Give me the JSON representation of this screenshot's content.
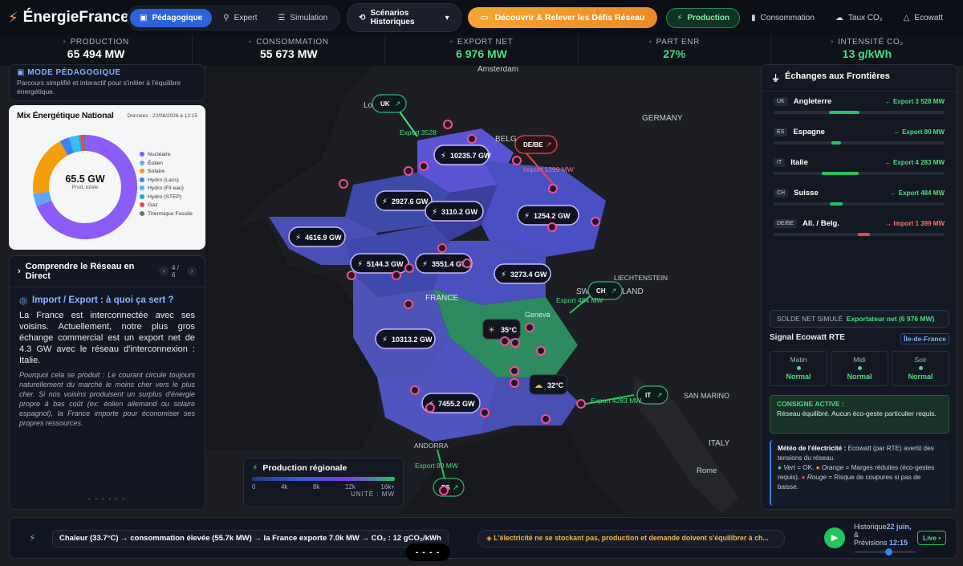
{
  "app": {
    "name": "ÉnergieFrance"
  },
  "nav": {
    "modes": [
      {
        "label": "Pédagogique",
        "icon": "book-icon",
        "active": true
      },
      {
        "label": "Expert",
        "icon": "chart-icon",
        "active": false
      },
      {
        "label": "Simulation",
        "icon": "sliders-icon",
        "active": false
      }
    ],
    "scenarios_label": "Scénarios Historiques",
    "cta_label": "Découvrir & Relever les Défis Réseau",
    "views": [
      {
        "label": "Production",
        "active": true
      },
      {
        "label": "Consommation",
        "active": false
      },
      {
        "label": "Taux CO₂",
        "active": false
      },
      {
        "label": "Ecowatt",
        "active": false
      }
    ]
  },
  "kpis": [
    {
      "label": "PRODUCTION",
      "value": "65 494 MW",
      "green": false
    },
    {
      "label": "CONSOMMATION",
      "value": "55 673 MW",
      "green": false
    },
    {
      "label": "EXPORT NET",
      "value": "6 976 MW",
      "green": true
    },
    {
      "label": "PART ENR",
      "value": "27%",
      "green": true
    },
    {
      "label": "INTENSITÉ CO₂",
      "value": "13 g/kWh",
      "green": true
    }
  ],
  "mode_panel": {
    "title": "MODE PÉDAGOGIQUE",
    "subtitle": "Parcours simplifié et interactif pour s'initier à l'équilibre énergétique."
  },
  "mix": {
    "title": "Mix Énergétique National",
    "date": "Données : 22/06/2026 à 12:15",
    "total": "65.5 GW",
    "total_label": "Prod. totale",
    "legend": [
      {
        "name": "Nucléaire",
        "color": "#8b5cf6"
      },
      {
        "name": "Éolien",
        "color": "#60a5fa"
      },
      {
        "name": "Solaire",
        "color": "#f59e0b"
      },
      {
        "name": "Hydro (Lacs)",
        "color": "#3b82f6"
      },
      {
        "name": "Hydro (Fil eau)",
        "color": "#38bdf8"
      },
      {
        "name": "Hydro (STEP)",
        "color": "#0ea5e9"
      },
      {
        "name": "Gaz",
        "color": "#ef4444"
      },
      {
        "name": "Thermique Fossile",
        "color": "#64748b"
      }
    ]
  },
  "chart_data": {
    "type": "pie",
    "title": "Mix Énergétique National",
    "categories": [
      "Nucléaire",
      "Éolien",
      "Solaire",
      "Hydro (Lacs)",
      "Hydro (Fil eau)",
      "Hydro (STEP)",
      "Gaz",
      "Thermique Fossile"
    ],
    "values": [
      69,
      4,
      19,
      3,
      3,
      0.5,
      1,
      0.5
    ]
  },
  "learn": {
    "title": "Comprendre le Réseau en Direct",
    "page": "4 / 6",
    "question": "Import / Export : à quoi ça sert ?",
    "body": "La France est interconnectée avec ses voisins. Actuellement, notre plus gros échange commercial est un export net de 4.3 GW avec le réseau d'interconnexion : Italie.",
    "note": "Pourquoi cela se produit : Le courant circule toujours naturellement du marché le moins cher vers le plus cher. Si nos voisins produisent un surplus d'énergie propre à bas coût (ex: éolien allemand ou solaire espagnol), la France importe pour économiser ses propres ressources.",
    "dots": "• • • • • •"
  },
  "exchanges": {
    "title": "Échanges aux Frontières",
    "rows": [
      {
        "code": "UK",
        "name": "Angleterre",
        "flow": "← Export 3 528 MW",
        "dir": "export"
      },
      {
        "code": "ES",
        "name": "Espagne",
        "flow": "← Export 80 MW",
        "dir": "export"
      },
      {
        "code": "IT",
        "name": "Italie",
        "flow": "← Export 4 283 MW",
        "dir": "export"
      },
      {
        "code": "CH",
        "name": "Suisse",
        "flow": "← Export 484 MW",
        "dir": "export"
      },
      {
        "code": "DE/BE",
        "name": "All. / Belg.",
        "flow": "→ Import 1 399 MW",
        "dir": "import"
      }
    ],
    "solde_label": "SOLDE NET SIMULÉ",
    "solde_value": "Exportateur net (6 976 MW)",
    "ecowatt_title": "Signal Ecowatt RTE",
    "region": "Île-de-France",
    "slots": [
      {
        "label": "Matin",
        "status": "Normal"
      },
      {
        "label": "Midi",
        "status": "Normal"
      },
      {
        "label": "Soir",
        "status": "Normal"
      }
    ],
    "consigne_title": "CONSIGNE ACTIVE :",
    "consigne_text": "Réseau équilibré. Aucun éco-geste particulier requis.",
    "meteo_title": "Météo de l'électricité :",
    "meteo_text": "Ecowatt (par RTE) avertit des tensions du réseau.",
    "meteo_green": "Vert",
    "meteo_green_text": "= OK.",
    "meteo_orange": "Orange",
    "meteo_orange_text": "= Marges réduites (éco-gestes requis).",
    "meteo_red": "Rouge",
    "meteo_red_text": "= Risque de coupures si pas de baisse."
  },
  "map": {
    "places": [
      "Amsterdam",
      "GERMANY",
      "LIECHTENSTEIN",
      "Geneva",
      "SAN MARINO",
      "ITALY",
      "Rome",
      "ANDORRA",
      "FRANCE",
      "BELG",
      "SWITZ",
      "LAND",
      "Lon"
    ],
    "regions": [
      {
        "value": "10235.7 GW"
      },
      {
        "value": "2927.6 GW"
      },
      {
        "value": "3110.2 GW"
      },
      {
        "value": "1254.2 GW"
      },
      {
        "value": "4616.9 GW"
      },
      {
        "value": "5144.3 GW"
      },
      {
        "value": "3551.4 GW"
      },
      {
        "value": "3273.4 GW"
      },
      {
        "value": "10313.2 GW"
      },
      {
        "value": "7455.2 GW"
      }
    ],
    "weather": [
      {
        "value": "35°C"
      },
      {
        "value": "32°C"
      }
    ],
    "borders": [
      {
        "code": "UK",
        "flow": "Export 3528"
      },
      {
        "code": "DE/BE",
        "flow": "Import 1399 MW"
      },
      {
        "code": "CH",
        "flow": "Export 484 MW"
      },
      {
        "code": "IT",
        "flow": "Export 4283 MW"
      },
      {
        "code": "ES",
        "flow": "Export 80 MW"
      }
    ],
    "gauge_title": "Production régionale",
    "gauge_ticks": [
      "0",
      "4k",
      "8k",
      "12k",
      "16k+"
    ],
    "gauge_unit": "UNITÉ : MW"
  },
  "bottom": {
    "chain": "Chaleur (33.7°C) → consommation élevée (55.7k MW) → la France exporte 7.0k MW → CO₂ : 12 gCO₂/kWh",
    "tip": "L'électricité ne se stockant pas, production et demande doivent s'équilibrer à ch...",
    "hist_label": "Historique",
    "hist_amp": "&",
    "hist_prev": "Prévisions",
    "date": "22 juin,",
    "time": "12:15",
    "live": "Live •",
    "dash": "- - - -"
  }
}
